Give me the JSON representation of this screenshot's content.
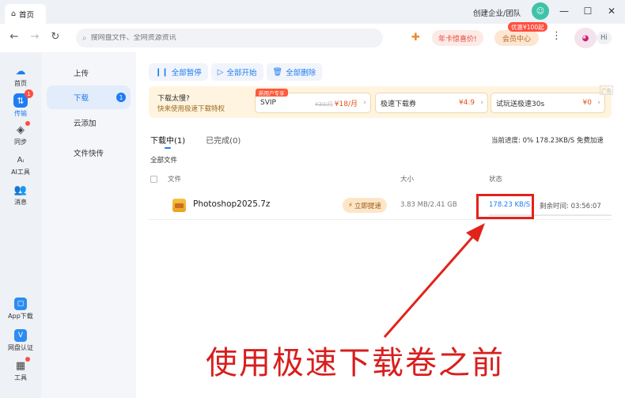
{
  "window": {
    "tab_title": "首页",
    "org_link": "创建企业/团队",
    "controls": {
      "minimize": "—",
      "maximize": "☐",
      "close": "✕"
    }
  },
  "addressbar": {
    "back": "←",
    "forward": "→",
    "refresh": "↻",
    "search_placeholder": "搜网盘文件、全网资源资讯",
    "promo_label": "年卡惊喜价!",
    "vip_label": "会员中心",
    "vip_badge": "优惠¥100起",
    "more": "⋮",
    "greeting": "Hi"
  },
  "rail": {
    "items": [
      {
        "label": "首页",
        "icon": "home-icon"
      },
      {
        "label": "传输",
        "icon": "transfer-icon",
        "badge": "1"
      },
      {
        "label": "同步",
        "icon": "sync-icon"
      },
      {
        "label": "AI工具",
        "icon": "ai-icon"
      },
      {
        "label": "消息",
        "icon": "message-icon"
      },
      {
        "label": "App下载",
        "icon": "app-download-icon"
      },
      {
        "label": "网盘认证",
        "icon": "verify-icon"
      },
      {
        "label": "工具",
        "icon": "tools-icon"
      }
    ]
  },
  "subnav": {
    "items": [
      {
        "label": "上传"
      },
      {
        "label": "下载",
        "badge": "1"
      },
      {
        "label": "云添加"
      },
      {
        "label": "文件快传"
      }
    ]
  },
  "toolbar": {
    "pause_all": "全部暂停",
    "start_all": "全部开始",
    "delete_all": "全部删除"
  },
  "banner": {
    "line1": "下载太慢?",
    "line2": "快来使用极速下载特权",
    "ad_label": "广告",
    "offers": [
      {
        "tag": "新用户专享",
        "name": "SVIP",
        "old_price": "¥30/月",
        "price": "¥18/月"
      },
      {
        "name": "极速下载券",
        "price": "¥4.9"
      },
      {
        "name": "试玩送极速30s",
        "price": "¥0"
      }
    ]
  },
  "tabs": {
    "downloading": "下载中(1)",
    "completed": "已完成(0)"
  },
  "status": {
    "text": "当前进度: 0%   178.23KB/S   免费加速"
  },
  "list": {
    "all_files": "全部文件",
    "columns": {
      "file": "文件",
      "size": "大小",
      "status": "状态"
    },
    "rows": [
      {
        "name": "Photoshop2025.7z",
        "boost": "立即提速",
        "size": "3.83 MB/2.41 GB",
        "speed": "178.23 KB/S",
        "remaining": "剩余时间: 03:56:07",
        "progress": 0
      }
    ]
  },
  "annotation": {
    "caption": "使用极速下载卷之前",
    "color": "#d81e1e"
  }
}
